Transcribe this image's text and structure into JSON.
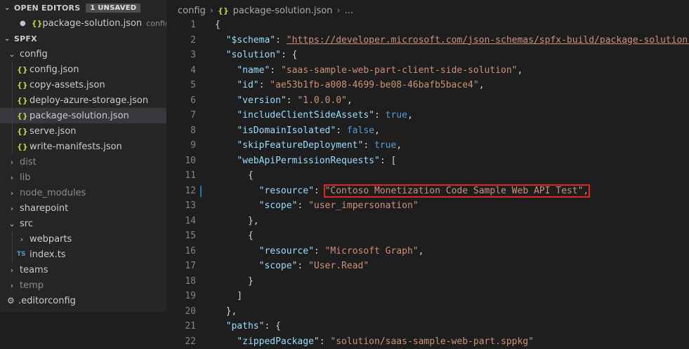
{
  "sidebar": {
    "open_editors": {
      "title": "OPEN EDITORS",
      "badge": "1 UNSAVED",
      "file": {
        "dot": "●",
        "name": "package-solution.json",
        "desc": "config"
      }
    },
    "project": {
      "title": "SPFX",
      "items": [
        {
          "label": "config",
          "kind": "folder-open",
          "depth": 1
        },
        {
          "label": "config.json",
          "kind": "json",
          "depth": 2
        },
        {
          "label": "copy-assets.json",
          "kind": "json",
          "depth": 2
        },
        {
          "label": "deploy-azure-storage.json",
          "kind": "json",
          "depth": 2
        },
        {
          "label": "package-solution.json",
          "kind": "json",
          "depth": 2,
          "selected": true
        },
        {
          "label": "serve.json",
          "kind": "json",
          "depth": 2
        },
        {
          "label": "write-manifests.json",
          "kind": "json",
          "depth": 2
        },
        {
          "label": "dist",
          "kind": "folder",
          "depth": 1,
          "dim": true
        },
        {
          "label": "lib",
          "kind": "folder",
          "depth": 1,
          "dim": true
        },
        {
          "label": "node_modules",
          "kind": "folder",
          "depth": 1,
          "dim": true
        },
        {
          "label": "sharepoint",
          "kind": "folder",
          "depth": 1
        },
        {
          "label": "src",
          "kind": "folder-open",
          "depth": 1
        },
        {
          "label": "webparts",
          "kind": "folder",
          "depth": 2
        },
        {
          "label": "index.ts",
          "kind": "ts",
          "depth": 2
        },
        {
          "label": "teams",
          "kind": "folder",
          "depth": 1
        },
        {
          "label": "temp",
          "kind": "folder",
          "depth": 1,
          "dim": true
        },
        {
          "label": ".editorconfig",
          "kind": "gear",
          "depth": 1
        }
      ]
    },
    "icons": {
      "json": "{}",
      "ts": "TS",
      "gear": "⚙"
    }
  },
  "breadcrumb": {
    "folder": "config",
    "file": "package-solution.json",
    "more": "..."
  },
  "editor": {
    "lines": [
      {
        "n": "1"
      },
      {
        "n": "2"
      },
      {
        "n": "3"
      },
      {
        "n": "4"
      },
      {
        "n": "5"
      },
      {
        "n": "6"
      },
      {
        "n": "7"
      },
      {
        "n": "8"
      },
      {
        "n": "9"
      },
      {
        "n": "10"
      },
      {
        "n": "11"
      },
      {
        "n": "12"
      },
      {
        "n": "13"
      },
      {
        "n": "14"
      },
      {
        "n": "15"
      },
      {
        "n": "16"
      },
      {
        "n": "17"
      },
      {
        "n": "18"
      },
      {
        "n": "19"
      },
      {
        "n": "20"
      },
      {
        "n": "21"
      },
      {
        "n": "22"
      }
    ],
    "code": {
      "l1": "{",
      "schema_key": "\"$schema\"",
      "schema_val": "\"https://developer.microsoft.com/json-schemas/spfx-build/package-solution.s",
      "solution_key": "\"solution\"",
      "name_key": "\"name\"",
      "name_val": "\"saas-sample-web-part-client-side-solution\"",
      "id_key": "\"id\"",
      "id_val": "\"ae53b1fb-a008-4699-be08-46bafb5bace4\"",
      "version_key": "\"version\"",
      "version_val": "\"1.0.0.0\"",
      "include_key": "\"includeClientSideAssets\"",
      "include_val": "true",
      "isolated_key": "\"isDomainIsolated\"",
      "isolated_val": "false",
      "skip_key": "\"skipFeatureDeployment\"",
      "skip_val": "true",
      "webapi_key": "\"webApiPermissionRequests\"",
      "resource_key": "\"resource\"",
      "resource1_val": "\"Contoso Monetization Code Sample Web API Test\",",
      "scope_key": "\"scope\"",
      "scope1_val": "\"user_impersonation\"",
      "resource2_val": "\"Microsoft Graph\"",
      "scope2_val": "\"User.Read\"",
      "paths_key": "\"paths\"",
      "zipped_key": "\"zippedPackage\"",
      "zipped_val": "\"solution/saas-sample-web-part.sppkg\""
    }
  }
}
